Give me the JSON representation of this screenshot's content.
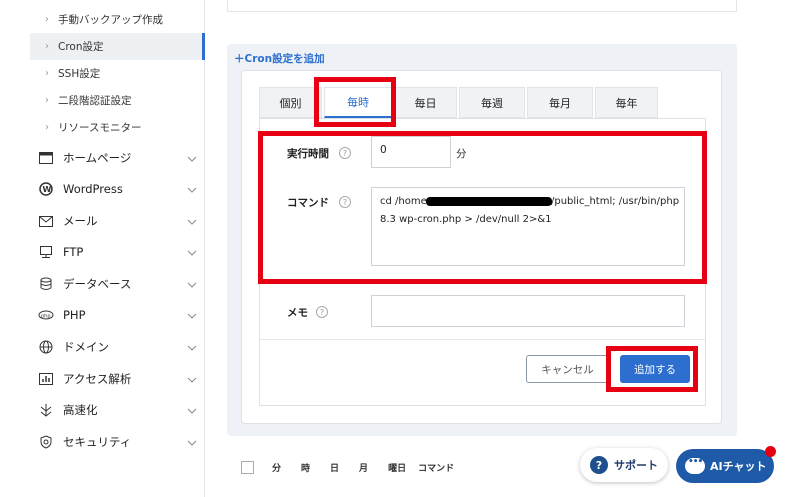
{
  "sidebar": {
    "sub_items": [
      {
        "label": "手動バックアップ作成"
      },
      {
        "label": "Cron設定"
      },
      {
        "label": "SSH設定"
      },
      {
        "label": "二段階認証設定"
      },
      {
        "label": "リソースモニター"
      }
    ],
    "nav_items": [
      {
        "label": "ホームページ",
        "icon": "browser-window-icon"
      },
      {
        "label": "WordPress",
        "icon": "wordpress-icon"
      },
      {
        "label": "メール",
        "icon": "envelope-icon"
      },
      {
        "label": "FTP",
        "icon": "ftp-monitor-icon"
      },
      {
        "label": "データベース",
        "icon": "database-icon"
      },
      {
        "label": "PHP",
        "icon": "php-icon"
      },
      {
        "label": "ドメイン",
        "icon": "globe-icon"
      },
      {
        "label": "アクセス解析",
        "icon": "bar-chart-icon"
      },
      {
        "label": "高速化",
        "icon": "speed-icon"
      },
      {
        "label": "セキュリティ",
        "icon": "shield-icon"
      }
    ]
  },
  "cron": {
    "add_link": "Cron設定を追加",
    "tabs": [
      "個別",
      "毎時",
      "毎日",
      "毎週",
      "毎月",
      "毎年"
    ],
    "active_tab": "毎時",
    "time_label": "実行時間",
    "time_value": "0",
    "time_unit": "分",
    "command_label": "コマンド",
    "command_line1_pre": "cd /home/",
    "command_line1_post": "/public_html; /usr/bin/php",
    "command_line2": "8.3 wp-cron.php > /dev/null 2>&1",
    "memo_label": "メモ",
    "memo_value": "",
    "cancel_label": "キャンセル",
    "submit_label": "追加する"
  },
  "table": {
    "columns": [
      "分",
      "時",
      "日",
      "月",
      "曜日",
      "コマンド"
    ]
  },
  "floating": {
    "support_label": "サポート",
    "ai_label": "AIチャット"
  },
  "colors": {
    "accent": "#2d6fcf",
    "highlight": "#e60012",
    "chat": "#1f5aa8"
  }
}
